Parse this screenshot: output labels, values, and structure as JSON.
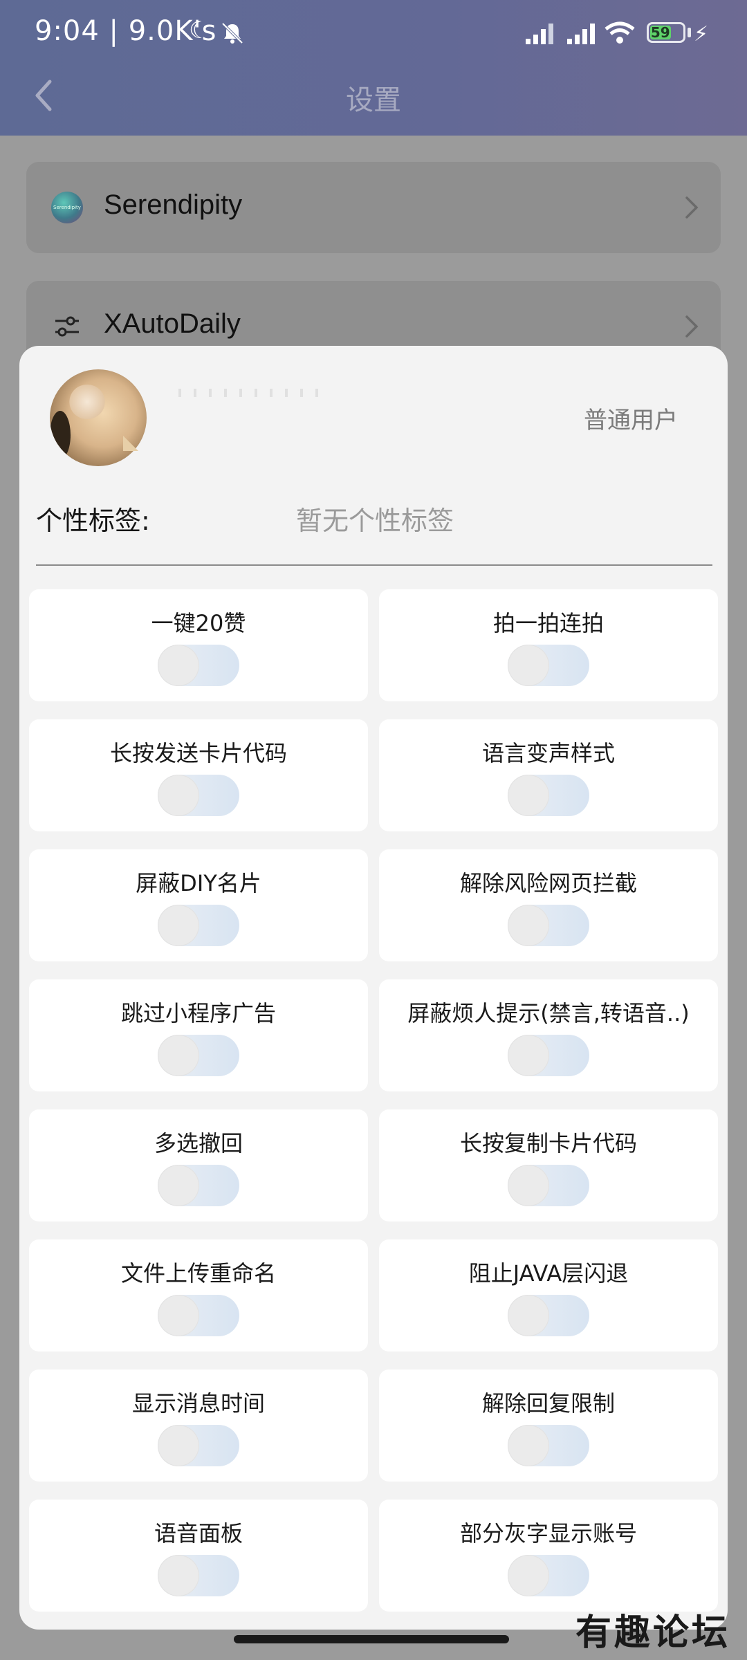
{
  "status_bar": {
    "time": "9:04 | 9.0K's",
    "moon_icon": "moon-icon",
    "battery_level": "59",
    "battery_color": "#5fd36a"
  },
  "header": {
    "title": "设置",
    "back_icon": "chevron-left-icon"
  },
  "background_list": [
    {
      "label": "Serendipity",
      "icon": "serendipity-app-icon",
      "icon_text": "Serendipity"
    },
    {
      "label": "XAutoDaily",
      "icon": "sliders-icon"
    }
  ],
  "profile": {
    "role": "普通用户",
    "signature_label": "个性标签:",
    "signature_value": "暂无个性标签"
  },
  "toggles": [
    {
      "label": "一键20赞",
      "on": false
    },
    {
      "label": "拍一拍连拍",
      "on": false
    },
    {
      "label": "长按发送卡片代码",
      "on": false
    },
    {
      "label": "语言变声样式",
      "on": false
    },
    {
      "label": "屏蔽DIY名片",
      "on": false
    },
    {
      "label": "解除风险网页拦截",
      "on": false
    },
    {
      "label": "跳过小程序广告",
      "on": false
    },
    {
      "label": "屏蔽烦人提示(禁言,转语音..)",
      "on": false
    },
    {
      "label": "多选撤回",
      "on": false
    },
    {
      "label": "长按复制卡片代码",
      "on": false
    },
    {
      "label": "文件上传重命名",
      "on": false
    },
    {
      "label": "阻止JAVA层闪退",
      "on": false
    },
    {
      "label": "显示消息时间",
      "on": false
    },
    {
      "label": "解除回复限制",
      "on": false
    },
    {
      "label": "语音面板",
      "on": false
    },
    {
      "label": "部分灰字显示账号",
      "on": false
    }
  ],
  "watermark": "有趣论坛"
}
